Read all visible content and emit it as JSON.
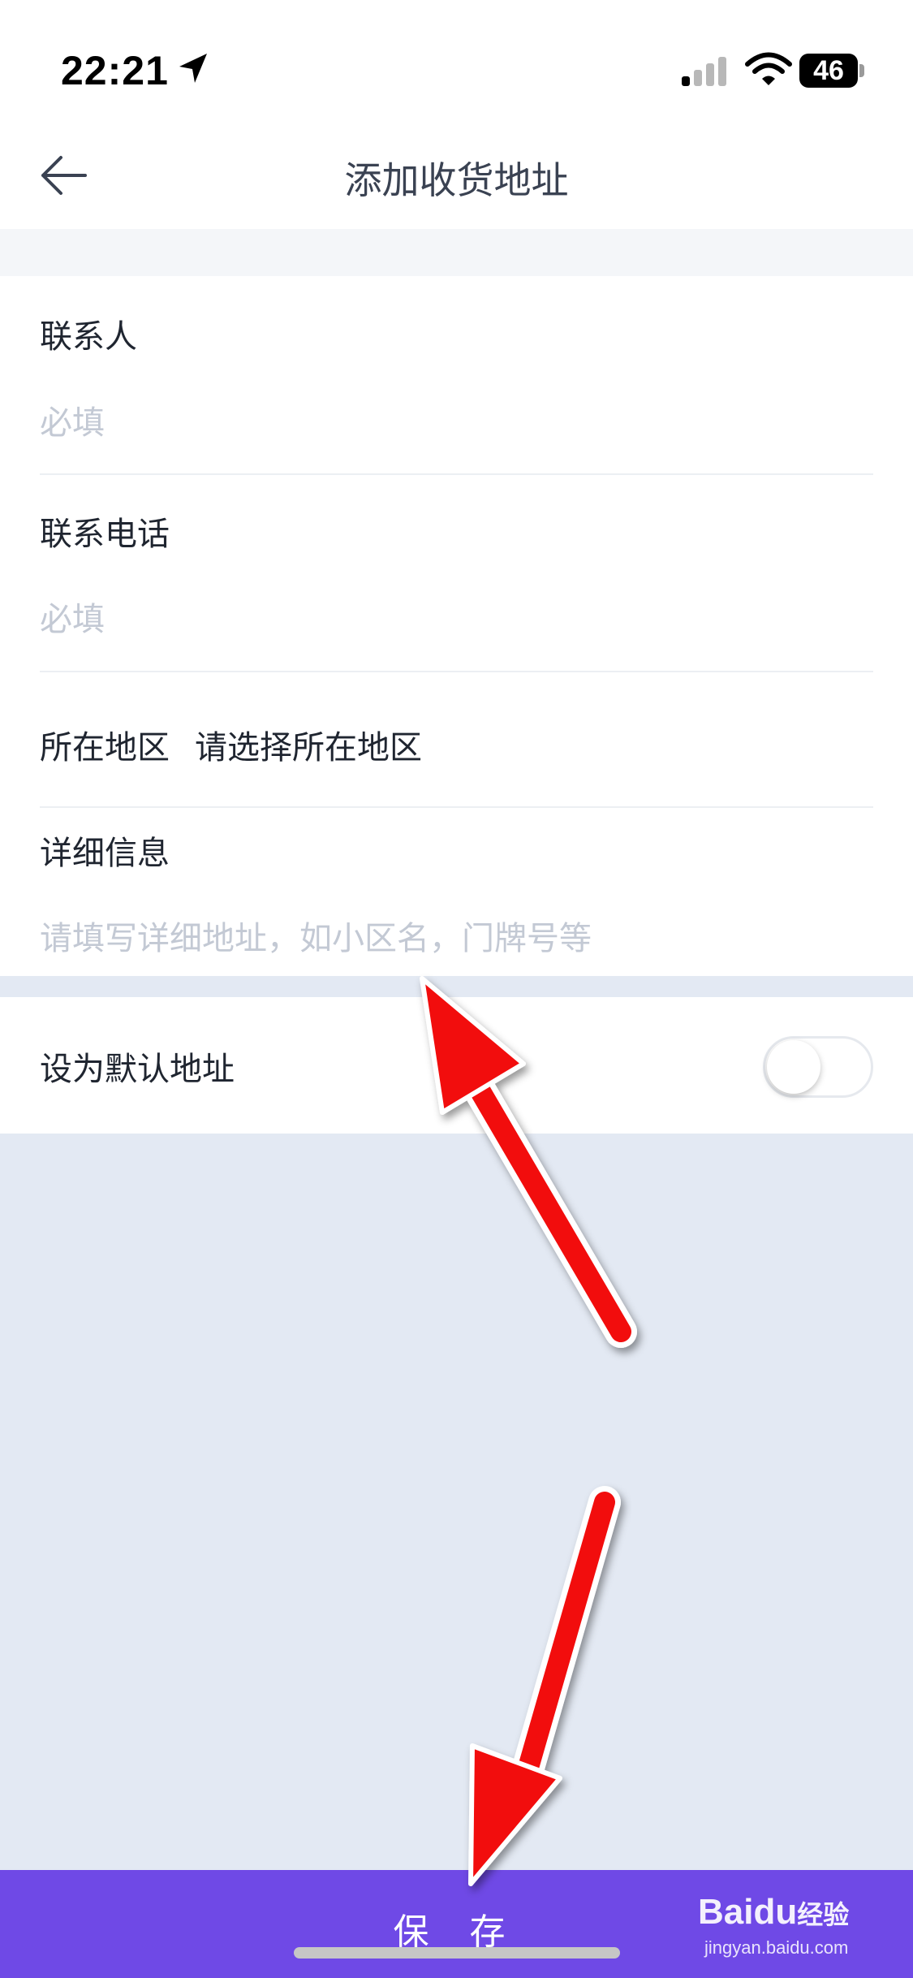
{
  "status_bar": {
    "time": "22:21",
    "battery": "46",
    "icons": [
      "location-arrow-icon",
      "cellular-signal-icon",
      "wifi-icon",
      "battery-icon"
    ]
  },
  "nav": {
    "back_icon": "arrow-left-icon",
    "title": "添加收货地址"
  },
  "form": {
    "contact": {
      "label": "联系人",
      "placeholder": "必填"
    },
    "phone": {
      "label": "联系电话",
      "placeholder": "必填"
    },
    "region": {
      "label": "所在地区",
      "value": "请选择所在地区"
    },
    "detail": {
      "label": "详细信息",
      "placeholder": "请填写详细地址，如小区名，门牌号等"
    }
  },
  "default_address": {
    "label": "设为默认地址",
    "enabled": false
  },
  "save_button": {
    "label": "保 存"
  },
  "watermark": {
    "brand": "Bai",
    "brand_paw": "du",
    "suffix": "经验",
    "url": "jingyan.baidu.com"
  },
  "colors": {
    "accent": "#6f49e6",
    "page_background": "#e3e9f3",
    "annotation_arrow": "#f20d0d"
  }
}
